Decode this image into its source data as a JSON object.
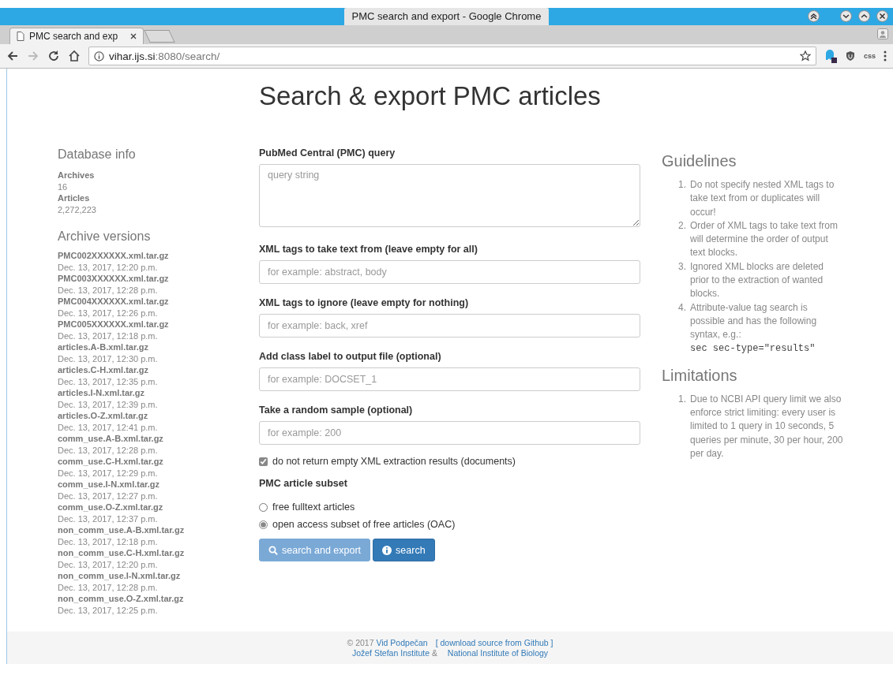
{
  "browser": {
    "window_title": "PMC search and export - Google Chrome",
    "tabs": [
      {
        "label": "PMC search and exp",
        "selected": true
      }
    ],
    "url": {
      "host": "vihar.ijs.si",
      "rest": ":8080/search/"
    },
    "forward_disabled": true,
    "extension_label": "css"
  },
  "page": {
    "title": "Search & export PMC articles",
    "database_info": {
      "heading": "Database info",
      "items": [
        {
          "label": "Archives",
          "value": "16"
        },
        {
          "label": "Articles",
          "value": "2,272,223"
        }
      ]
    },
    "archive_versions": {
      "heading": "Archive versions",
      "items": [
        {
          "name": "PMC002XXXXXX.xml.tar.gz",
          "date": "Dec. 13, 2017, 12:20 p.m."
        },
        {
          "name": "PMC003XXXXXX.xml.tar.gz",
          "date": "Dec. 13, 2017, 12:28 p.m."
        },
        {
          "name": "PMC004XXXXXX.xml.tar.gz",
          "date": "Dec. 13, 2017, 12:26 p.m."
        },
        {
          "name": "PMC005XXXXXX.xml.tar.gz",
          "date": "Dec. 13, 2017, 12:18 p.m."
        },
        {
          "name": "articles.A-B.xml.tar.gz",
          "date": "Dec. 13, 2017, 12:30 p.m."
        },
        {
          "name": "articles.C-H.xml.tar.gz",
          "date": "Dec. 13, 2017, 12:35 p.m."
        },
        {
          "name": "articles.I-N.xml.tar.gz",
          "date": "Dec. 13, 2017, 12:39 p.m."
        },
        {
          "name": "articles.O-Z.xml.tar.gz",
          "date": "Dec. 13, 2017, 12:41 p.m."
        },
        {
          "name": "comm_use.A-B.xml.tar.gz",
          "date": "Dec. 13, 2017, 12:28 p.m."
        },
        {
          "name": "comm_use.C-H.xml.tar.gz",
          "date": "Dec. 13, 2017, 12:29 p.m."
        },
        {
          "name": "comm_use.I-N.xml.tar.gz",
          "date": "Dec. 13, 2017, 12:27 p.m."
        },
        {
          "name": "comm_use.O-Z.xml.tar.gz",
          "date": "Dec. 13, 2017, 12:37 p.m."
        },
        {
          "name": "non_comm_use.A-B.xml.tar.gz",
          "date": "Dec. 13, 2017, 12:18 p.m."
        },
        {
          "name": "non_comm_use.C-H.xml.tar.gz",
          "date": "Dec. 13, 2017, 12:20 p.m."
        },
        {
          "name": "non_comm_use.I-N.xml.tar.gz",
          "date": "Dec. 13, 2017, 12:28 p.m."
        },
        {
          "name": "non_comm_use.O-Z.xml.tar.gz",
          "date": "Dec. 13, 2017, 12:25 p.m."
        }
      ]
    },
    "form": {
      "fields": [
        {
          "kind": "textarea",
          "label": "PubMed Central (PMC) query",
          "placeholder": "query string"
        },
        {
          "kind": "text",
          "label": "XML tags to take text from (leave empty for all)",
          "placeholder": "for example: abstract, body"
        },
        {
          "kind": "text",
          "label": "XML tags to ignore (leave empty for nothing)",
          "placeholder": "for example: back, xref"
        },
        {
          "kind": "text",
          "label": "Add class label to output file (optional)",
          "placeholder": "for example: DOCSET_1"
        },
        {
          "kind": "text",
          "label": "Take a random sample (optional)",
          "placeholder": "for example: 200"
        }
      ],
      "checkbox": {
        "label": "do not return empty XML extraction results (documents)",
        "checked": true
      },
      "subset": {
        "label": "PMC article subset",
        "options": [
          {
            "label": "free fulltext articles",
            "selected": false
          },
          {
            "label": "open access subset of free articles (OAC)",
            "selected": true
          }
        ]
      },
      "buttons": [
        {
          "kind": "search",
          "label": "search and export",
          "disabled": true
        },
        {
          "kind": "info",
          "label": "search",
          "disabled": false
        }
      ]
    },
    "guidelines": {
      "heading": "Guidelines",
      "items": [
        {
          "number": "1.",
          "text": "Do not specify nested XML tags to take text from or duplicates will occur!"
        },
        {
          "number": "2.",
          "text": "Order of XML tags to take text from will determine the order of output text blocks."
        },
        {
          "number": "3.",
          "text": "Ignored XML blocks are deleted prior to the extraction of wanted blocks."
        },
        {
          "number": "4.",
          "text": "Attribute-value tag search is possible and has the following syntax, e.g.:",
          "code": "sec sec-type=\"results\""
        }
      ]
    },
    "limitations": {
      "heading": "Limitations",
      "items": [
        {
          "number": "1.",
          "text": "Due to NCBI API query limit we also enforce strict limiting: every user is limited to 1 query in 10 seconds, 5 queries per minute, 30 per hour, 200 per day."
        }
      ]
    },
    "footer": {
      "lines": [
        [
          {
            "kind": "text",
            "text": "© 2017 "
          },
          {
            "kind": "link",
            "text": "Vid Podpečan"
          },
          {
            "kind": "link",
            "text": "[ download source from Github ]"
          }
        ],
        [
          {
            "kind": "link",
            "text": "Jožef Stefan Institute"
          },
          {
            "kind": "text",
            "text": " & "
          },
          {
            "kind": "link",
            "text": "National Institute of Biology"
          }
        ]
      ]
    }
  }
}
